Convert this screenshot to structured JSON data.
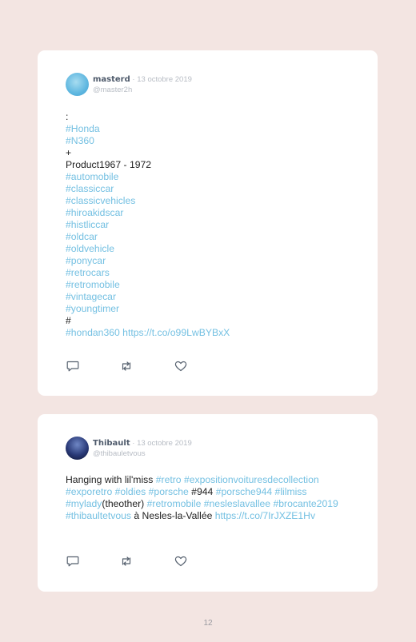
{
  "tweets": [
    {
      "author": "masterd",
      "sep": " · ",
      "date": "13 octobre 2019",
      "handle": "@master2h",
      "lines": [
        {
          "text": ":",
          "tag": false
        },
        {
          "text": "#Honda",
          "tag": true
        },
        {
          "text": "#N360",
          "tag": true
        },
        {
          "text": "+",
          "tag": false
        },
        {
          "text": "Product1967 - 1972",
          "tag": false
        },
        {
          "text": "#automobile",
          "tag": true
        },
        {
          "text": "#classiccar",
          "tag": true
        },
        {
          "text": "#classicvehicles",
          "tag": true
        },
        {
          "text": "#hiroakidscar",
          "tag": true
        },
        {
          "text": "#histliccar",
          "tag": true
        },
        {
          "text": "#oldcar",
          "tag": true
        },
        {
          "text": "#oldvehicle",
          "tag": true
        },
        {
          "text": "#ponycar",
          "tag": true
        },
        {
          "text": "#retrocars",
          "tag": true
        },
        {
          "text": "#retromobile",
          "tag": true
        },
        {
          "text": "#vintagecar",
          "tag": true
        },
        {
          "text": "#youngtimer",
          "tag": true
        },
        {
          "text": "#",
          "tag": false
        },
        {
          "text": "#hondan360 https://t.co/o99LwBYBxX",
          "tag": true
        }
      ]
    },
    {
      "author": "Thibault",
      "sep": " · ",
      "date": "13 octobre 2019",
      "handle": "@thibauletvous",
      "segments": [
        {
          "text": "Hanging with lil'miss ",
          "tag": false
        },
        {
          "text": "#retro #expositionvoituresdecollection #exporetro #oldies #porsche",
          "tag": true
        },
        {
          "text": " #944 ",
          "tag": false
        },
        {
          "text": "#porsche944 #lilmiss #mylady",
          "tag": true
        },
        {
          "text": "(theother) ",
          "tag": false
        },
        {
          "text": "#retromobile #nesleslavallee #brocante2019 #thibaultetvous",
          "tag": true
        },
        {
          "text": " à Nesles-la-Vallée ",
          "tag": false
        },
        {
          "text": "https://t.co/7IrJXZE1Hv",
          "tag": true
        }
      ]
    }
  ],
  "actions": {
    "reply_icon": "reply-icon",
    "retweet_icon": "retweet-icon",
    "like_icon": "heart-icon"
  },
  "colors": {
    "background": "#f3e5e2",
    "card": "#ffffff",
    "hashtag": "#74c0e2",
    "meta": "#b7bcc4"
  },
  "page_number": "12"
}
